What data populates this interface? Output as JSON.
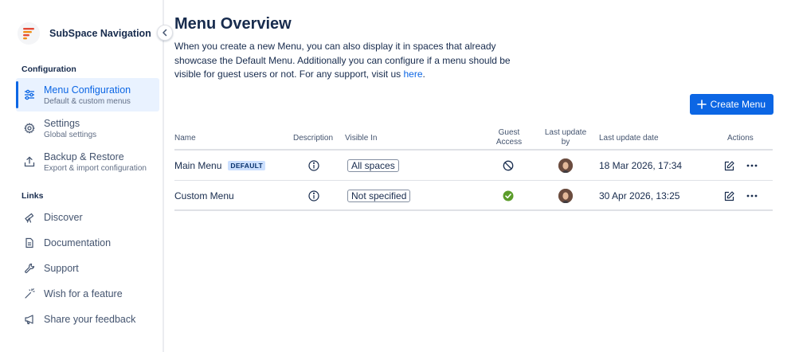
{
  "app": {
    "title": "SubSpace Navigation",
    "collapse_icon": "chevron-left-icon"
  },
  "sidebar": {
    "configuration_label": "Configuration",
    "links_label": "Links",
    "config_items": [
      {
        "title": "Menu Configuration",
        "subtitle": "Default & custom menus",
        "icon": "sliders-icon",
        "active": true
      },
      {
        "title": "Settings",
        "subtitle": "Global settings",
        "icon": "gear-icon",
        "active": false
      },
      {
        "title": "Backup & Restore",
        "subtitle": "Export & import configuration",
        "icon": "upload-icon",
        "active": false
      }
    ],
    "link_items": [
      {
        "title": "Discover",
        "icon": "telescope-icon"
      },
      {
        "title": "Documentation",
        "icon": "document-icon"
      },
      {
        "title": "Support",
        "icon": "wrench-icon"
      },
      {
        "title": "Wish for a feature",
        "icon": "magic-wand-icon"
      },
      {
        "title": "Share your feedback",
        "icon": "megaphone-icon"
      }
    ]
  },
  "main": {
    "title": "Menu Overview",
    "intro_text": "When you create a new Menu, you can also display it in spaces that already showcase the Default Menu. Additionally you can configure if a menu should be visible for guest users or not. For any support, visit us ",
    "intro_link": "here",
    "intro_end": ".",
    "create_button": "Create Menu"
  },
  "table": {
    "headers": {
      "name": "Name",
      "description": "Description",
      "visible_in": "Visible In",
      "guest_access_1": "Guest",
      "guest_access_2": "Access",
      "last_update_by_1": "Last update",
      "last_update_by_2": "by",
      "last_update_date": "Last update date",
      "actions": "Actions"
    },
    "rows": [
      {
        "name": "Main Menu",
        "badge": "DEFAULT",
        "visible_in": "All spaces",
        "guest_access": "denied",
        "last_update_date": "18 Mar 2026, 17:34"
      },
      {
        "name": "Custom Menu",
        "badge": "",
        "visible_in": "Not specified",
        "guest_access": "allowed",
        "last_update_date": "30 Apr 2026, 13:25"
      }
    ]
  },
  "colors": {
    "primary": "#0c66e4",
    "active_bg": "#e9f2ff",
    "success": "#5b9c2a",
    "badge_bg": "#cce0ff",
    "logo_red": "#e34935",
    "logo_orange": "#f18d13"
  }
}
